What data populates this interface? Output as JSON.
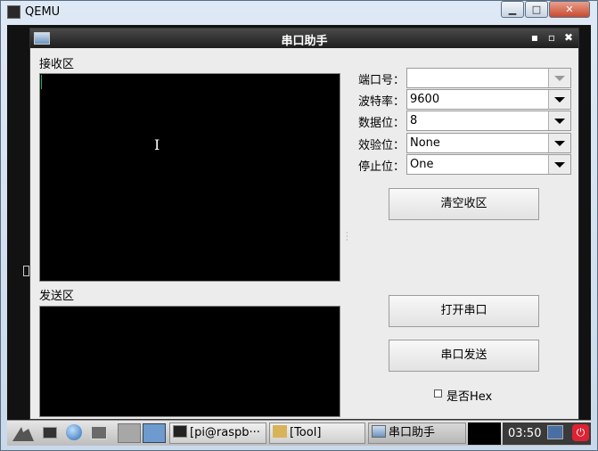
{
  "qemu": {
    "title": "QEMU",
    "minimize": "▁",
    "maximize": "□",
    "close": "✕"
  },
  "app": {
    "title": "串口助手",
    "title_controls": {
      "minimize": "▪",
      "maximize": "▫",
      "close": "✖"
    },
    "receive_label": "接收区",
    "send_label": "发送区",
    "fields": [
      {
        "label": "端口号：",
        "value": ""
      },
      {
        "label": "波特率：",
        "value": "9600"
      },
      {
        "label": "数据位：",
        "value": "8"
      },
      {
        "label": "效验位：",
        "value": "None"
      },
      {
        "label": "停止位：",
        "value": "One"
      }
    ],
    "clear_button": "清空收区",
    "open_button": "打开串口",
    "send_button": "串口发送",
    "hex_checkbox": {
      "label": "是否Hex",
      "checked": false
    }
  },
  "taskbar": {
    "items": [
      {
        "label": "[pi@raspb···"
      },
      {
        "label": "[Tool]"
      },
      {
        "label": "串口助手"
      }
    ],
    "clock": "03:50"
  }
}
